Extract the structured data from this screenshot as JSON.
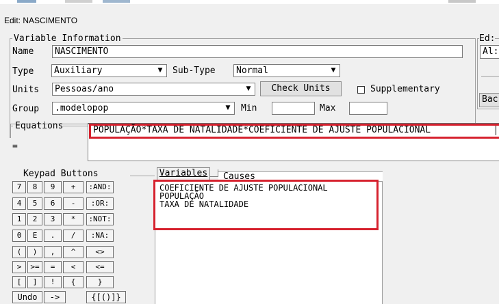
{
  "window": {
    "title": "Edit: NASCIMENTO"
  },
  "variable_info": {
    "legend": "Variable Information",
    "name_label": "Name",
    "name_value": "NASCIMENTO",
    "type_label": "Type",
    "type_value": "Auxiliary",
    "subtype_label": "Sub-Type",
    "subtype_value": "Normal",
    "units_label": "Units",
    "units_value": "Pessoas/ano",
    "check_units_label": "Check Units",
    "supplementary_label": "Supplementary",
    "group_label": "Group",
    "group_value": ".modelopop",
    "min_label": "Min",
    "min_value": "",
    "max_label": "Max",
    "max_value": ""
  },
  "right_panel": {
    "legend_partial": "Ed:",
    "field_partial": "Al:",
    "button_partial": "Bac"
  },
  "equations": {
    "legend": "Equations",
    "equals_sign": "=",
    "text": "POPULAÇÃO*TAXA DE NATALIDADE*COEFICIENTE DE AJUSTE POPULACIONAL"
  },
  "keypad": {
    "legend": "Keypad Buttons",
    "rows": [
      [
        "7",
        "8",
        "9",
        "+",
        ":AND:"
      ],
      [
        "4",
        "5",
        "6",
        "-",
        ":OR:"
      ],
      [
        "1",
        "2",
        "3",
        "*",
        ":NOT:"
      ],
      [
        "0",
        "E",
        ".",
        "/",
        ":NA:"
      ],
      [
        "(",
        ")",
        ",",
        "^",
        "<>"
      ],
      [
        ">",
        ">=",
        "=",
        "<",
        "<="
      ],
      [
        "[",
        "]",
        "!",
        "{",
        "}"
      ]
    ],
    "bottom": [
      "Undo",
      "->",
      "{[()]}"
    ]
  },
  "variables_tab": {
    "tabs": [
      "Variables",
      "Causes"
    ],
    "items": [
      "COEFICIENTE DE AJUSTE POPULACIONAL",
      "POPULAÇÃO",
      "TAXA DE NATALIDADE"
    ]
  },
  "colors": {
    "highlight": "#d6212e"
  }
}
